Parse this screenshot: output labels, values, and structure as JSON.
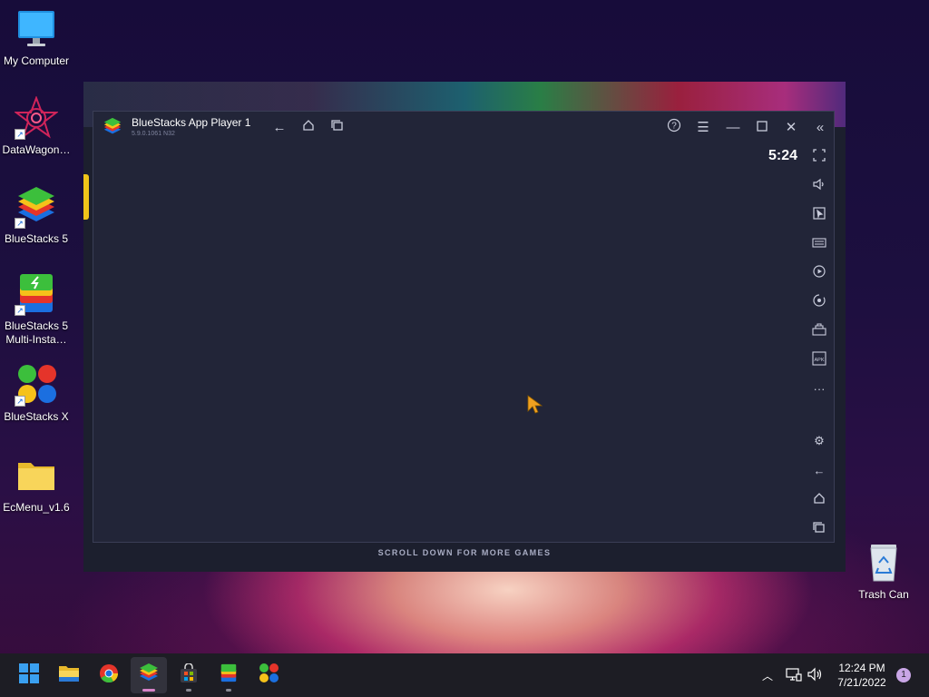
{
  "desktop": {
    "icons": [
      {
        "label": "My Computer",
        "icon": "monitor-icon"
      },
      {
        "label": "DataWagon…",
        "icon": "datawagon-icon"
      },
      {
        "label": "BlueStacks 5",
        "icon": "bluestacks-icon"
      },
      {
        "label": "BlueStacks 5 Multi-Insta…",
        "icon": "bluestacks-multi-icon"
      },
      {
        "label": "BlueStacks X",
        "icon": "bluestacks-x-icon"
      },
      {
        "label": "EcMenu_v1.6",
        "icon": "folder-icon"
      }
    ],
    "trash": {
      "label": "Trash Can",
      "icon": "recycle-bin-icon"
    }
  },
  "launcher": {
    "scroll_hint": "SCROLL DOWN FOR MORE GAMES"
  },
  "player": {
    "title": "BlueStacks App Player 1",
    "version": "5.9.0.1061  N32",
    "clock": "5:24",
    "titlebar_icons": [
      "back-icon",
      "home-icon",
      "recent-apps-icon",
      "help-icon",
      "menu-icon",
      "minimize-icon",
      "maximize-icon",
      "close-icon",
      "collapse-sidebar-icon"
    ],
    "sidebar_icons": [
      "fullscreen-icon",
      "volume-icon",
      "pointer-icon",
      "keyboard-icon",
      "record-icon",
      "rotate-icon",
      "macro-icon",
      "apk-icon",
      "more-icon",
      "settings-icon",
      "android-back-icon",
      "android-home-icon",
      "android-recents-icon"
    ]
  },
  "taskbar": {
    "apps": [
      "start-icon",
      "file-explorer-icon",
      "chrome-icon",
      "bluestacks-icon",
      "store-icon",
      "bluestacks-multi-icon",
      "bluestacks-x-icon"
    ],
    "time": "12:24 PM",
    "date": "7/21/2022",
    "notification_count": "1"
  },
  "colors": {
    "accent": "#f0c419",
    "window_bg": "#222538",
    "taskbar_bg": "#1d1d24",
    "active_indicator": "#d783c8"
  }
}
